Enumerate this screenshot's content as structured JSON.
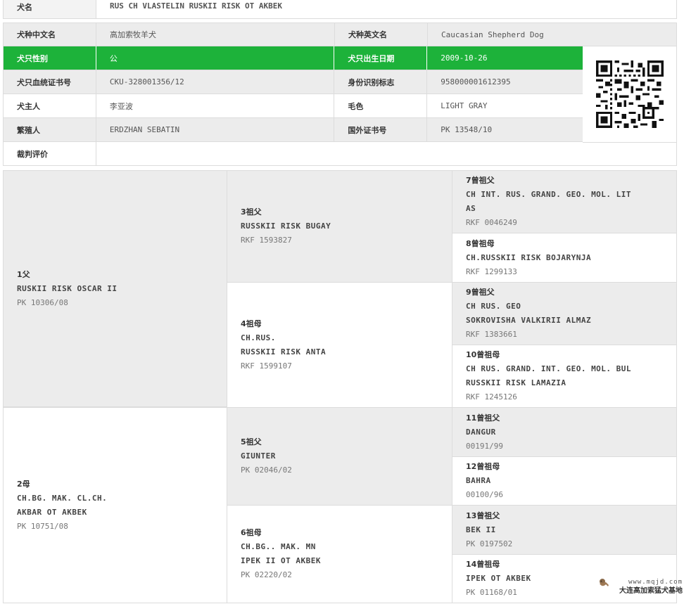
{
  "info": {
    "name_label": "犬名",
    "name_value": "RUS CH VLASTELIN RUSKII RISK OT AKBEK",
    "breed_cn_label": "犬种中文名",
    "breed_cn_value": "高加索牧羊犬",
    "breed_en_label": "犬种英文名",
    "breed_en_value": "Caucasian Shepherd Dog",
    "sex_label": "犬只性别",
    "sex_value": "公",
    "dob_label": "犬只出生日期",
    "dob_value": "2009-10-26",
    "cert_label": "犬只血统证书号",
    "cert_value": "CKU-328001356/12",
    "id_label": "身份识别标志",
    "id_value": "958000001612395",
    "owner_label": "犬主人",
    "owner_value": "李亚波",
    "color_label": "毛色",
    "color_value": "LIGHT GRAY",
    "breeder_label": "繁殖人",
    "breeder_value": "ERDZHAN SEBATIN",
    "foreign_label": "国外证书号",
    "foreign_value": "PK 13548/10",
    "judge_label": "裁判评价",
    "judge_value": ""
  },
  "pedigree": {
    "sire": {
      "title": "1父",
      "name": "RUSKII RISK OSCAR II",
      "reg": "PK 10306/08"
    },
    "dam": {
      "title": "2母",
      "name1": "CH.BG. MAK. CL.CH.",
      "name2": "AKBAR OT AKBEK",
      "reg": "PK 10751/08"
    },
    "g3": {
      "title": "3祖父",
      "name": "RUSSKII RISK BUGAY",
      "reg": "RKF 1593827"
    },
    "g4": {
      "title": "4祖母",
      "name1": "CH.RUS.",
      "name2": "RUSSKII RISK ANTA",
      "reg": "RKF 1599107"
    },
    "g5": {
      "title": "5祖父",
      "name": "GIUNTER",
      "reg": "PK 02046/02"
    },
    "g6": {
      "title": "6祖母",
      "name1": "CH.BG.. MAK. MN",
      "name2": "IPEK II OT AKBEK",
      "reg": "PK 02220/02"
    },
    "gg7": {
      "title": "7曾祖父",
      "name1": "CH INT. RUS. GRAND. GEO. MOL. LIT",
      "name2": "AS",
      "reg": "RKF 0046249"
    },
    "gg8": {
      "title": "8曾祖母",
      "name": "CH.RUSSKII RISK BOJARYNJA",
      "reg": "RKF 1299133"
    },
    "gg9": {
      "title": "9曾祖父",
      "name1": "CH RUS. GEO",
      "name2": "SOKROVISHA VALKIRII ALMAZ",
      "reg": "RKF 1383661"
    },
    "gg10": {
      "title": "10曾祖母",
      "name1": "CH RUS. GRAND. INT. GEO. MOL. BUL",
      "name2": "RUSSKII RISK LAMAZIA",
      "reg": "RKF 1245126"
    },
    "gg11": {
      "title": "11曾祖父",
      "name": "DANGUR",
      "reg": "00191/99"
    },
    "gg12": {
      "title": "12曾祖母",
      "name": "BAHRA",
      "reg": "00100/96"
    },
    "gg13": {
      "title": "13曾祖父",
      "name": "BEK II",
      "reg": "PK 0197502"
    },
    "gg14": {
      "title": "14曾祖母",
      "name": "IPEK OT AKBEK",
      "reg": "PK 01168/01"
    }
  },
  "watermark": {
    "url": "www.mqjd.com",
    "text": "大连高加索猛犬基地"
  },
  "icons": {
    "qr": "qr-code-icon",
    "dog": "dog-logo-icon"
  },
  "colors": {
    "accent_green": "#1db23a",
    "row_gray": "#ececec",
    "border": "#dcdcdc"
  }
}
